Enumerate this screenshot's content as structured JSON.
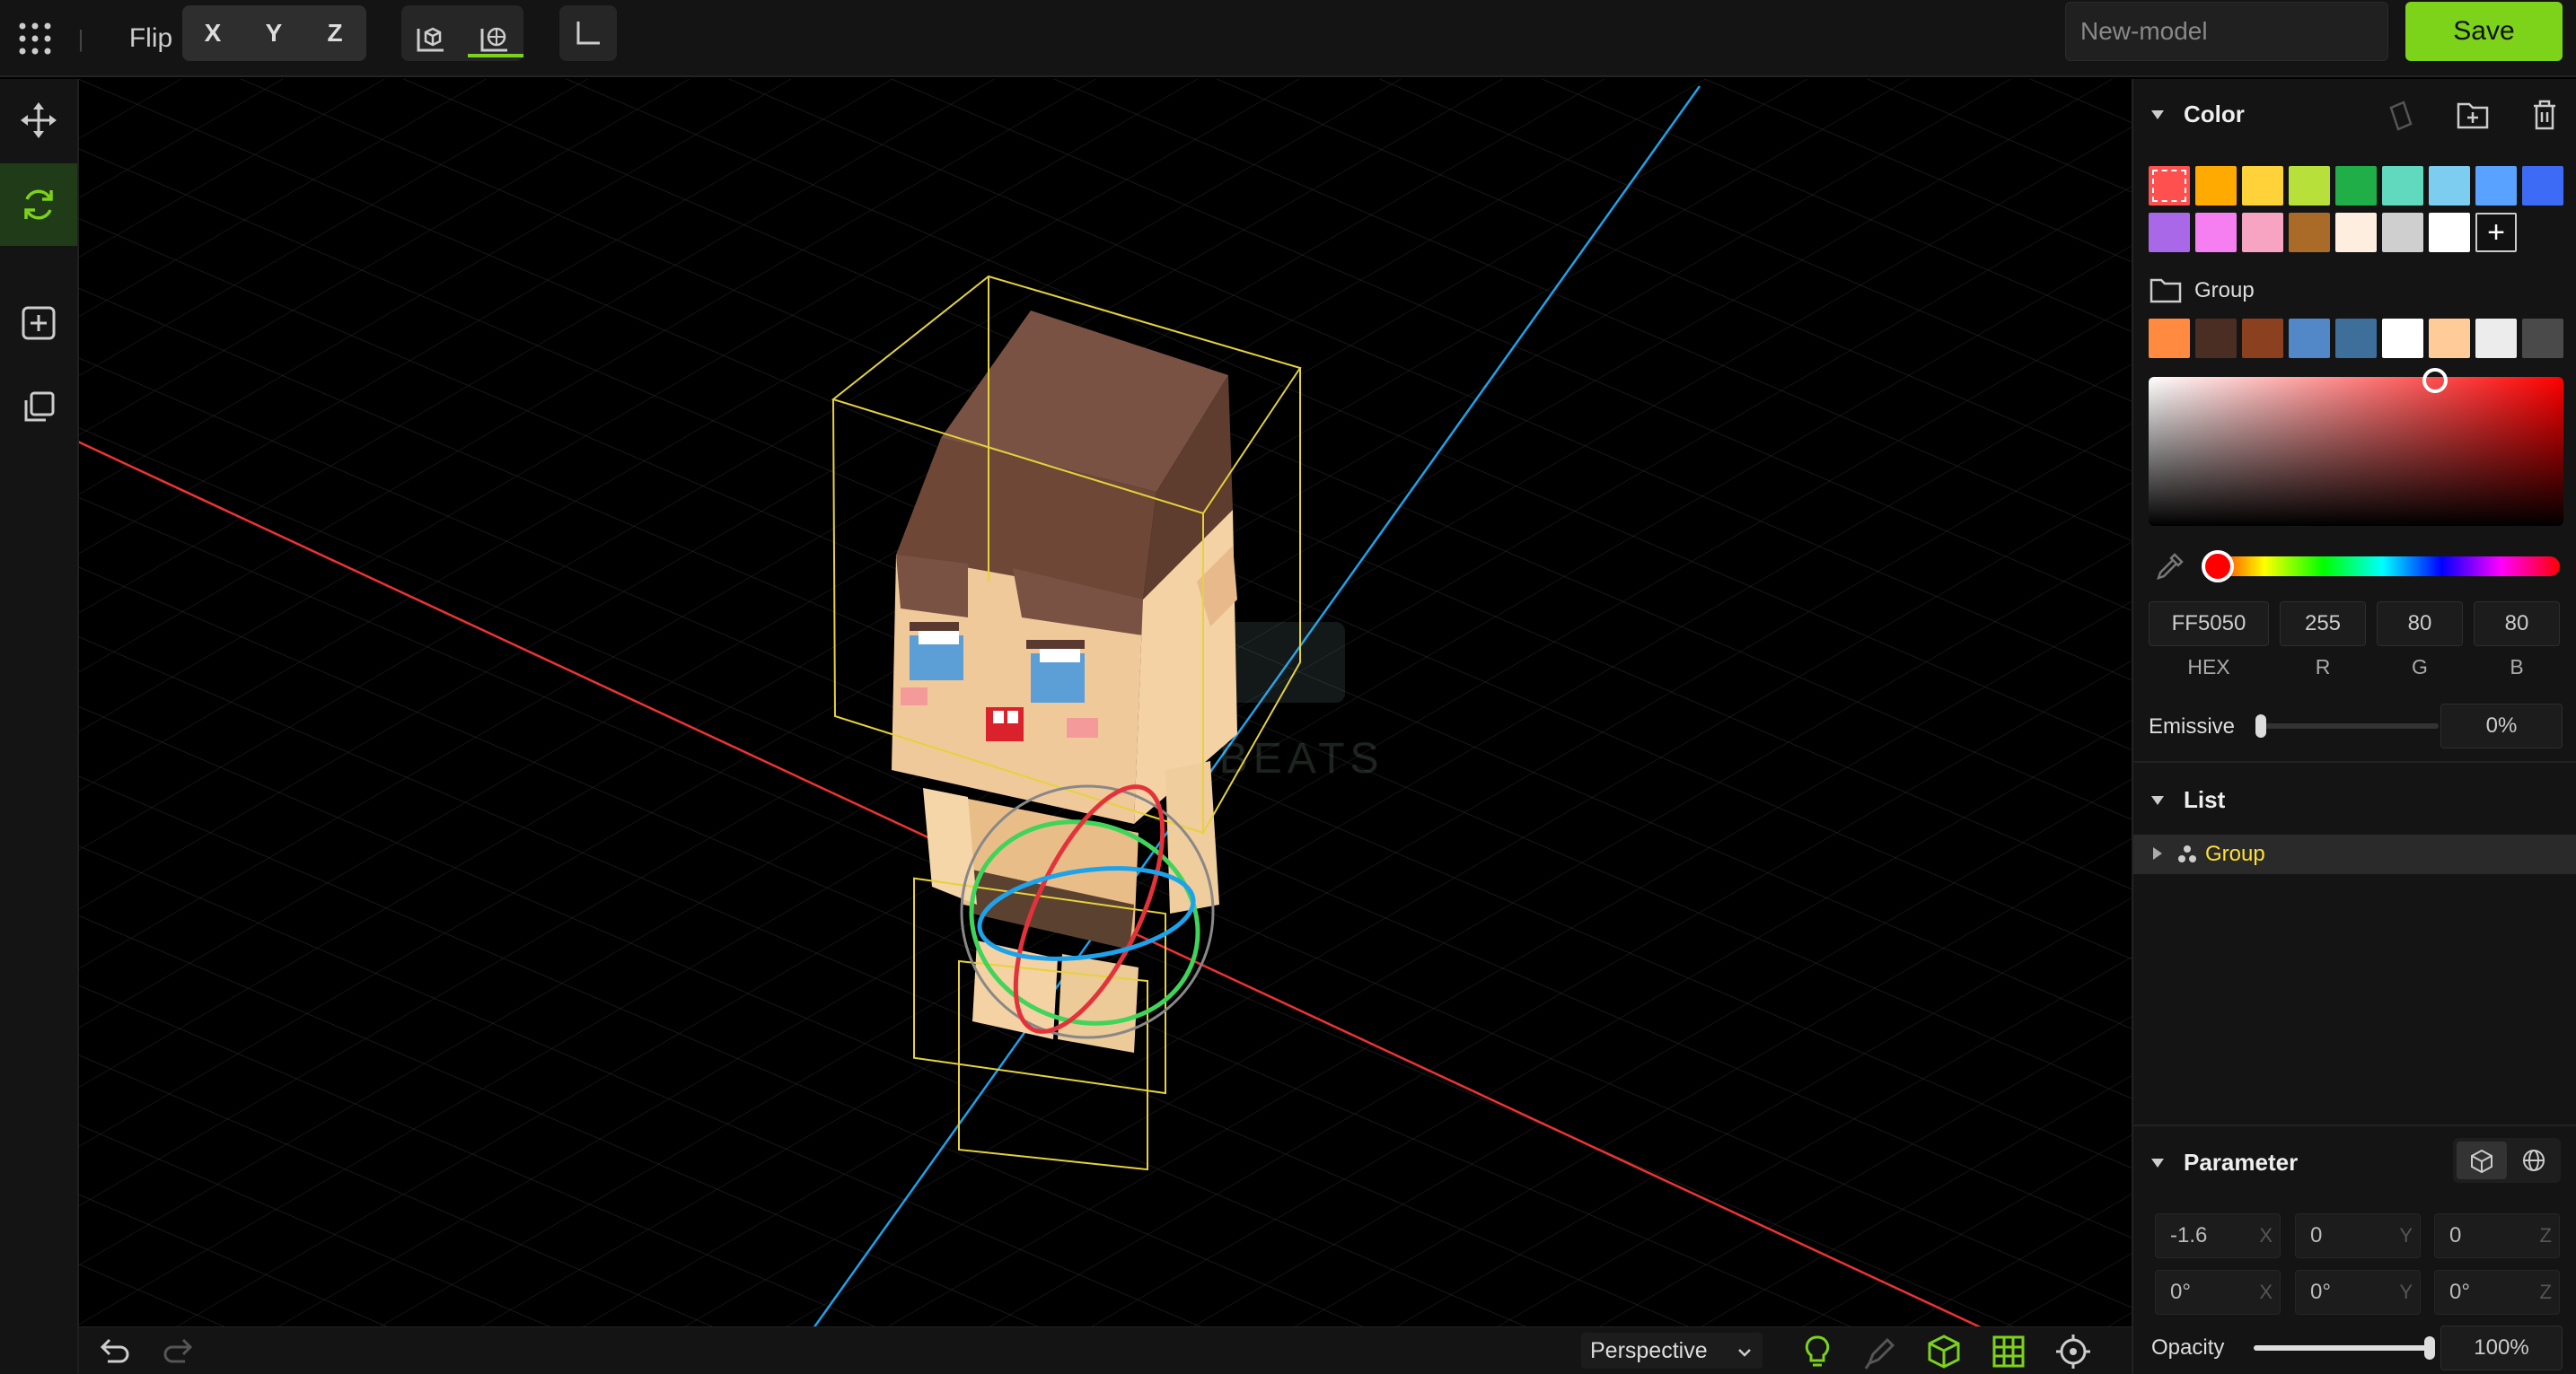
{
  "toolbar": {
    "flip_label": "Flip",
    "axes": [
      "X",
      "Y",
      "Z"
    ],
    "model_name": "New-model",
    "save_label": "Save"
  },
  "color_panel": {
    "title": "Color",
    "palette_row1": [
      "#ff5050",
      "#ffaa00",
      "#ffd23a",
      "#b7e03a",
      "#1fae48",
      "#60d9bf",
      "#7ccdf0",
      "#5aa2ff",
      "#3d6bf5"
    ],
    "palette_row2": [
      "#a968e8",
      "#f57ff0",
      "#f7a4c3",
      "#aa6a28",
      "#fdeee0",
      "#cfcfcf",
      "#ffffff"
    ],
    "group_label": "Group",
    "group_swatches": [
      "#ff8a40",
      "#4a2e24",
      "#8b4020",
      "#5288c8",
      "#3e6e9a",
      "#ffffff",
      "#ffcc99",
      "#ececec",
      "#4a4a4a"
    ],
    "hex": "FF5050",
    "r": "255",
    "g": "80",
    "b": "80",
    "hex_label": "HEX",
    "r_label": "R",
    "g_label": "G",
    "b_label": "B",
    "emissive_label": "Emissive",
    "emissive_value": "0%",
    "emissive_level": 0
  },
  "list_panel": {
    "title": "List",
    "items": [
      {
        "label": "Group"
      }
    ]
  },
  "parameter_panel": {
    "title": "Parameter",
    "position": {
      "x": "-1.6",
      "y": "0",
      "z": "0"
    },
    "rotation": {
      "x": "0°",
      "y": "0°",
      "z": "0°"
    },
    "axis_x": "X",
    "axis_y": "Y",
    "axis_z": "Z",
    "opacity_label": "Opacity",
    "opacity_value": "100%",
    "opacity_level": 1.0
  },
  "bottombar": {
    "view_mode": "Perspective"
  },
  "colors": {
    "accent": "#7dd21a",
    "list_item": "#ffe033"
  }
}
